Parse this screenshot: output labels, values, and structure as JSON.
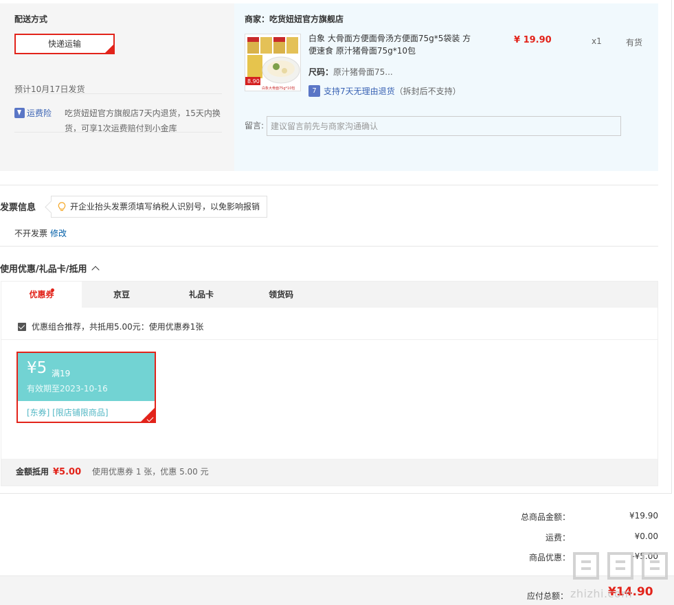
{
  "shipping": {
    "section_label": "配送方式",
    "method_label": "快递运输",
    "ship_date": "预计10月17日发货",
    "insurance_link": "运费险",
    "insurance_text": "吃货妞妞官方旗舰店7天内退货，15天内换货，可享1次运费赔付到小金库"
  },
  "order": {
    "seller": "商家：吃货妞妞官方旗舰店",
    "product_name": "白象 大骨面方便面骨汤方便面75g*5袋装 方便速食 原汁猪骨面75g*10包",
    "size_label": "尺码：",
    "size_value": "原汁猪骨面75...",
    "return_policy": "支持7天无理由退货",
    "return_note": "（拆封后不支持）",
    "price": "¥ 19.90",
    "quantity": "x1",
    "stock": "有货",
    "message_label": "留言:",
    "message_placeholder": "建议留言前先与商家沟通确认",
    "image_price_tag": "8.90",
    "image_caption": "白象大骨面75g*10包"
  },
  "invoice": {
    "title": "发票信息",
    "tip": "开企业抬头发票须填写纳税人识别号，以免影响报销",
    "value": "不开发票",
    "edit_link": "修改"
  },
  "coupons": {
    "title": "使用优惠/礼品卡/抵用",
    "tabs": [
      "优惠券",
      "京豆",
      "礼品卡",
      "领货码"
    ],
    "combo_text": "优惠组合推荐，共抵用5.00元：使用优惠券1张",
    "card": {
      "amount": "¥5",
      "condition": "满19",
      "expiry": "有效期至2023-10-16",
      "tags": "[东券] [限店铺限商品]"
    },
    "summary_label": "金额抵用",
    "summary_value": "¥5.00",
    "summary_desc": "使用优惠券 1 张，优惠 5.00 元"
  },
  "totals": {
    "goods_label": "总商品金额：",
    "goods_value": "¥19.90",
    "freight_label": "运费：",
    "freight_value": "¥0.00",
    "discount_label": "商品优惠：",
    "discount_value": "-¥5.00",
    "payable_label": "应付总额：",
    "payable_value": "¥14.90"
  },
  "watermark": {
    "glyph": "值",
    "text": "zhizhi.com"
  },
  "colors": {
    "accent": "#e2231a",
    "link": "#3a63b4",
    "coupon_teal": "#72d3d3",
    "shop_bg": "#f1f9fd"
  }
}
